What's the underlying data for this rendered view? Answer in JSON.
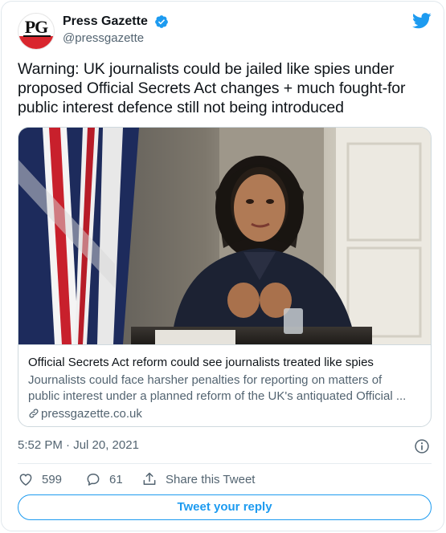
{
  "account": {
    "avatar_text": "PG",
    "display_name": "Press Gazette",
    "handle": "@pressgazette",
    "verified": true
  },
  "tweet": {
    "text": "Warning: UK journalists could be jailed like spies under proposed Official Secrets Act changes + much fought-for public interest defence still not being introduced",
    "timestamp": "5:52 PM · Jul 20, 2021"
  },
  "card": {
    "title": "Official Secrets Act reform could see journalists treated like spies",
    "description_line1": "Journalists could face harsher penalties for reporting on matters of",
    "description_line2": "public interest under a planned reform of the UK's antiquated Official ...",
    "domain": "pressgazette.co.uk",
    "image_desc": "photo-woman-speaking-at-table-with-union-flag"
  },
  "actions": {
    "likes": "599",
    "replies": "61",
    "share_label": "Share this Tweet",
    "reply_button": "Tweet your reply"
  },
  "colors": {
    "accent": "#1d9bf0",
    "text_primary": "#0f1419",
    "text_secondary": "#536471",
    "border": "#cfd9de"
  },
  "icons": [
    "verified-badge-icon",
    "twitter-bird-icon",
    "link-icon",
    "info-icon",
    "heart-icon",
    "reply-icon",
    "share-icon"
  ]
}
